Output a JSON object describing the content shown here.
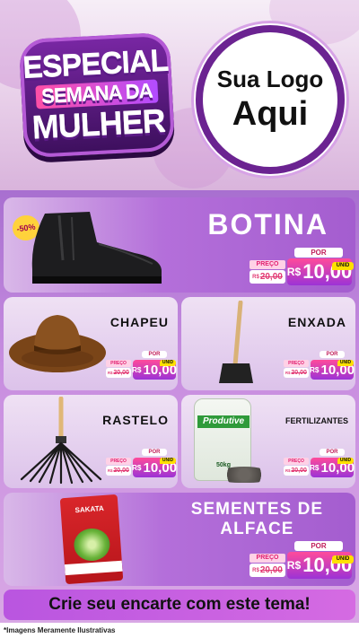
{
  "header": {
    "badge_line1": "ESPECIAL",
    "badge_line2": "SEMANA DA",
    "badge_line3": "MULHER",
    "logo_line1": "Sua Logo",
    "logo_line2": "Aqui"
  },
  "colors": {
    "accent_purple": "#6b2391",
    "price_gradient_start": "#ff4b9a",
    "price_gradient_end": "#9c33d6",
    "unid_yellow": "#ffe000"
  },
  "products": {
    "botina": {
      "name": "BOTINA",
      "discount": "-50%",
      "preco_label": "PREÇO",
      "old_currency": "R$",
      "old_price": "20,00",
      "por_label": "POR",
      "unid_label": "UNID",
      "currency": "R$",
      "price": "10,00"
    },
    "chapeu": {
      "name": "CHAPEU",
      "preco_label": "PREÇO",
      "old_currency": "R$",
      "old_price": "20,00",
      "por_label": "POR",
      "unid_label": "UNID",
      "currency": "R$",
      "price": "10,00"
    },
    "enxada": {
      "name": "ENXADA",
      "preco_label": "PREÇO",
      "old_currency": "R$",
      "old_price": "20,00",
      "por_label": "POR",
      "unid_label": "UNID",
      "currency": "R$",
      "price": "10,00"
    },
    "rastelo": {
      "name": "RASTELO",
      "preco_label": "PREÇO",
      "old_currency": "R$",
      "old_price": "20,00",
      "por_label": "POR",
      "unid_label": "UNID",
      "currency": "R$",
      "price": "10,00"
    },
    "fertilizantes": {
      "name": "FERTILIZANTES",
      "bag_brand": "Produtive",
      "bag_weight": "50kg",
      "preco_label": "PREÇO",
      "old_currency": "R$",
      "old_price": "20,00",
      "por_label": "POR",
      "unid_label": "UNID",
      "currency": "R$",
      "price": "10,00"
    },
    "sementes": {
      "name_line1": "SEMENTES DE",
      "name_line2": "ALFACE",
      "pack_brand": "SAKATA",
      "preco_label": "PREÇO",
      "old_currency": "R$",
      "old_price": "20,00",
      "por_label": "POR",
      "unid_label": "UNID",
      "currency": "R$",
      "price": "10,00"
    }
  },
  "cta": "Crie seu encarte com este tema!",
  "footer": "*Imagens Meramente Ilustrativas"
}
